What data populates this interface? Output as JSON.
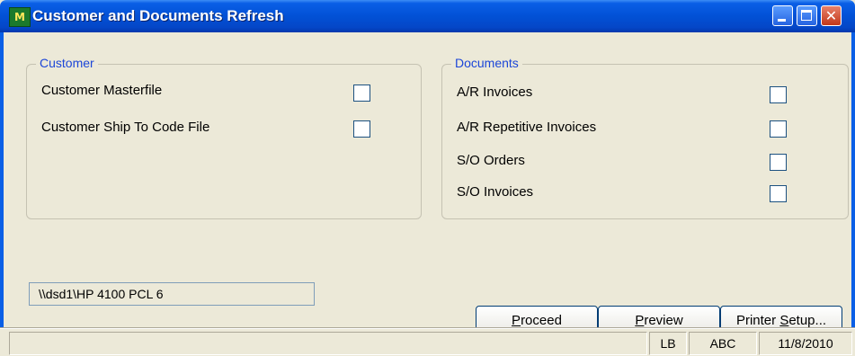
{
  "window": {
    "title": "Customer and Documents Refresh",
    "icon": "sage-mas90-app-icon",
    "icon_glyph": "M",
    "close_glyph": "✕",
    "colors": {
      "titlebar": "#0251d6",
      "group_label": "#1c46d8",
      "face": "#ece9d8"
    }
  },
  "customer_group": {
    "label": "Customer",
    "items": [
      {
        "label": "Customer Masterfile",
        "checked": false
      },
      {
        "label": "Customer Ship To Code File",
        "checked": false
      }
    ]
  },
  "documents_group": {
    "label": "Documents",
    "items": [
      {
        "label": "A/R Invoices",
        "checked": false
      },
      {
        "label": "A/R Repetitive Invoices",
        "checked": false
      },
      {
        "label": "S/O Orders",
        "checked": false
      },
      {
        "label": "S/O Invoices",
        "checked": false
      }
    ]
  },
  "printer": {
    "value": "\\\\dsd1\\HP 4100 PCL 6"
  },
  "buttons": {
    "proceed": {
      "hotkey": "P",
      "rest": "roceed"
    },
    "preview": {
      "hotkey": "P",
      "rest": "review"
    },
    "printer_setup": {
      "prefix": "Printer ",
      "hotkey": "S",
      "rest": "etup..."
    }
  },
  "statusbar": {
    "message": "",
    "user": "LB",
    "company": "ABC",
    "date": "11/8/2010"
  }
}
